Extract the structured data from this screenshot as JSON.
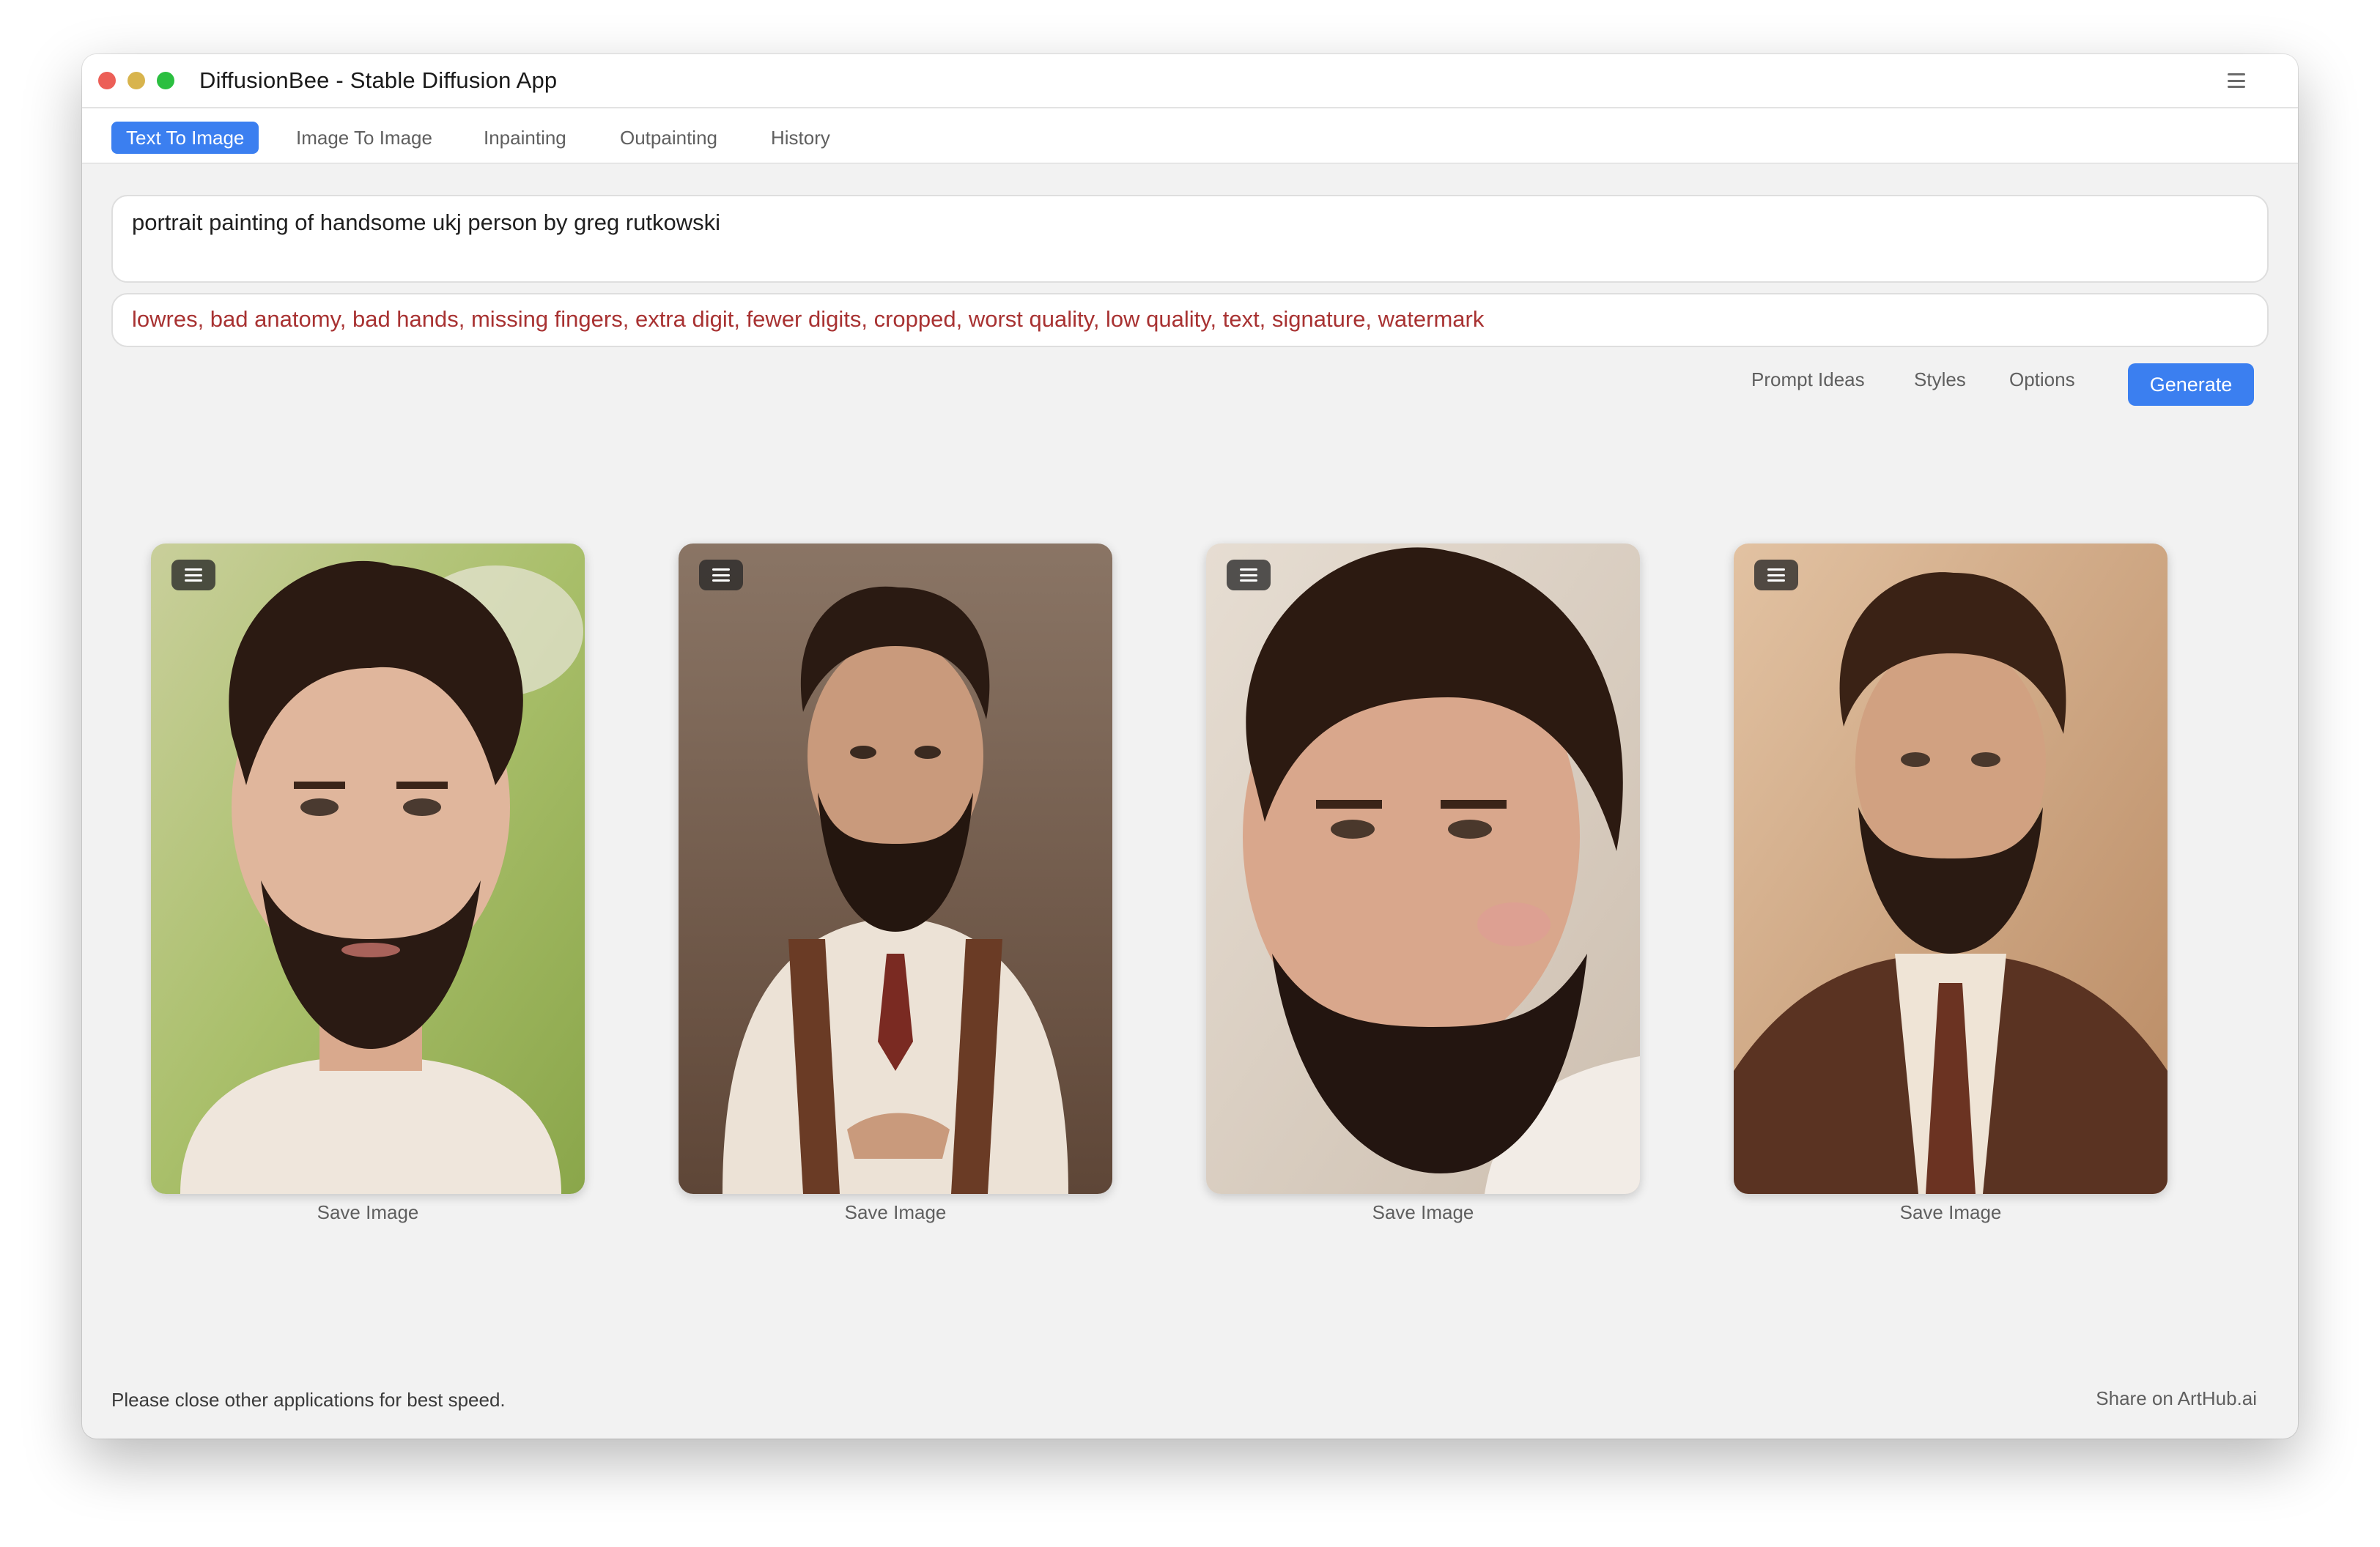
{
  "app": {
    "title": "DiffusionBee - Stable Diffusion App"
  },
  "tabs": [
    {
      "label": "Text To Image",
      "active": true
    },
    {
      "label": "Image To Image"
    },
    {
      "label": "Inpainting"
    },
    {
      "label": "Outpainting"
    },
    {
      "label": "History"
    }
  ],
  "prompt": {
    "value": "portrait painting of handsome ukj person by greg rutkowski"
  },
  "negative_prompt": {
    "value": "lowres, bad anatomy, bad hands, missing fingers, extra digit, fewer digits, cropped, worst quality, low quality, text, signature, watermark"
  },
  "actions": {
    "prompt_ideas": "Prompt Ideas",
    "styles": "Styles",
    "options": "Options",
    "generate": "Generate"
  },
  "results": [
    {
      "save_label": "Save Image"
    },
    {
      "save_label": "Save Image"
    },
    {
      "save_label": "Save Image"
    },
    {
      "save_label": "Save Image"
    }
  ],
  "footer": {
    "tip": "Please close other applications for best speed.",
    "share": "Share on ArtHub.ai"
  },
  "colors": {
    "accent": "#3b7ff0",
    "negative_text": "#a83232"
  }
}
